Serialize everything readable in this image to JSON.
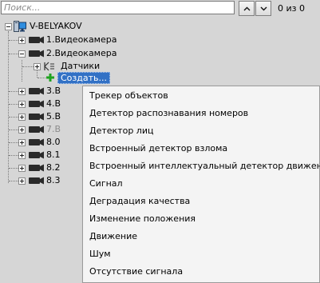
{
  "search": {
    "placeholder": "Поиск..."
  },
  "nav": {
    "up_icon": "chevron-up-icon",
    "down_icon": "chevron-down-icon"
  },
  "counter": "0 из 0",
  "tree": {
    "root": "V-BELYAKOV",
    "cameras": [
      {
        "label": "1.Видеокамера",
        "expanded": false
      },
      {
        "label": "2.Видеокамера",
        "expanded": true
      },
      {
        "label": "3.В",
        "expanded": false
      },
      {
        "label": "4.В",
        "expanded": false
      },
      {
        "label": "5.В",
        "expanded": false
      },
      {
        "label": "7.В",
        "expanded": false,
        "disabled": true
      },
      {
        "label": "8.0",
        "expanded": false
      },
      {
        "label": "8.1",
        "expanded": false
      },
      {
        "label": "8.2",
        "expanded": false
      },
      {
        "label": "8.3",
        "expanded": false
      }
    ],
    "sensors": "Датчики",
    "create": "Создать..."
  },
  "context_menu": {
    "items": [
      "Трекер объектов",
      "Детектор распознавания номеров",
      "Детектор лиц",
      "Встроенный детектор взлома",
      "Встроенный интеллектуальный детектор движения",
      "Сигнал",
      "Деградация качества",
      "Изменение положения",
      "Движение",
      "Шум",
      "Отсутствие сигнала"
    ]
  },
  "colors": {
    "selection": "#3271c5",
    "background": "#d6d6d6",
    "menu": "#f4f4f4",
    "create_plus": "#1fa31f"
  }
}
